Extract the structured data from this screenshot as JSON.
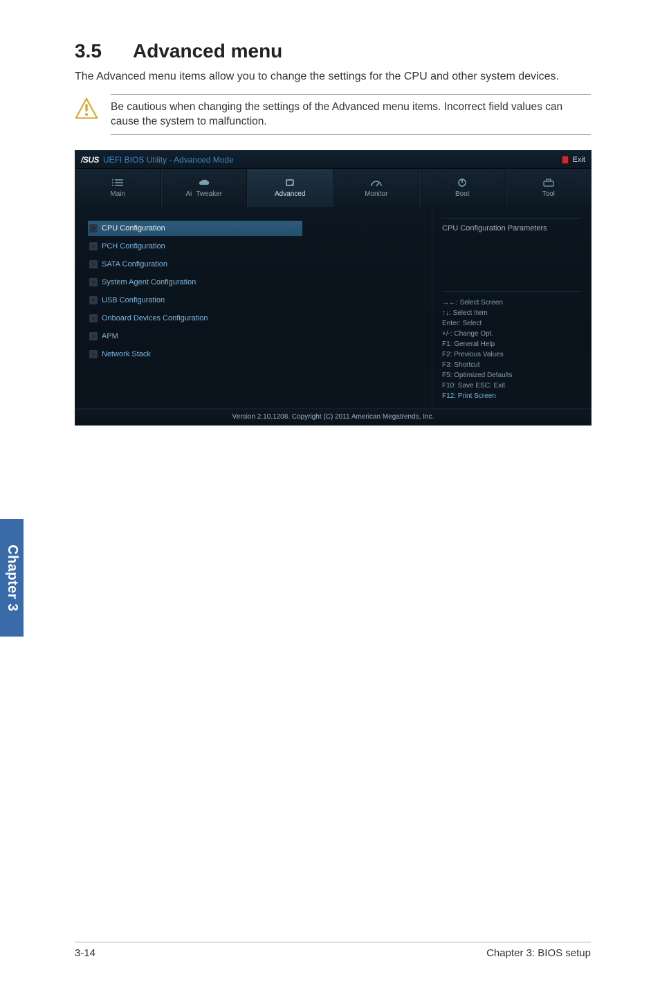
{
  "heading": {
    "number": "3.5",
    "title": "Advanced menu"
  },
  "intro": "The Advanced menu items allow you to change the settings for the CPU and other system devices.",
  "note": "Be cautious when changing the settings of the Advanced menu items. Incorrect field values can cause the system to malfunction.",
  "bios": {
    "logo": "/SUS",
    "title": "UEFI BIOS Utility - Advanced Mode",
    "exit_label": "Exit",
    "tabs": [
      {
        "label": "Main",
        "icon": "list-icon"
      },
      {
        "label_a": "Ai",
        "label_b": "Tweaker",
        "icon": "cloud-icon"
      },
      {
        "label": "Advanced",
        "icon": "chip-icon"
      },
      {
        "label": "Monitor",
        "icon": "gauge-icon"
      },
      {
        "label": "Boot",
        "icon": "power-icon"
      },
      {
        "label": "Tool",
        "icon": "toolbox-icon"
      }
    ],
    "items": [
      "CPU Configuration",
      "PCH Configuration",
      "SATA Configuration",
      "System Agent Configuration",
      "USB Configuration",
      "Onboard Devices Configuration",
      "APM",
      "Network Stack"
    ],
    "right_header": "CPU Configuration Parameters",
    "hints": {
      "l1a": "→←:",
      "l1b": "Select Screen",
      "l2a": "↑↓:",
      "l2b": "Select Item",
      "l3": "Enter: Select",
      "l4": "+/-: Change Opt.",
      "l5": "F1: General Help",
      "l6": "F2: Previous Values",
      "l7": "F3: Shortcut",
      "l8": "F5: Optimized Defaults",
      "l9": "F10: Save   ESC: Exit",
      "l10": "F12: Print Screen"
    },
    "footer": "Version 2.10.1208. Copyright (C) 2011 American Megatrends, Inc."
  },
  "side_tab": "Chapter 3",
  "page_footer": {
    "left": "3-14",
    "right": "Chapter 3: BIOS setup"
  }
}
